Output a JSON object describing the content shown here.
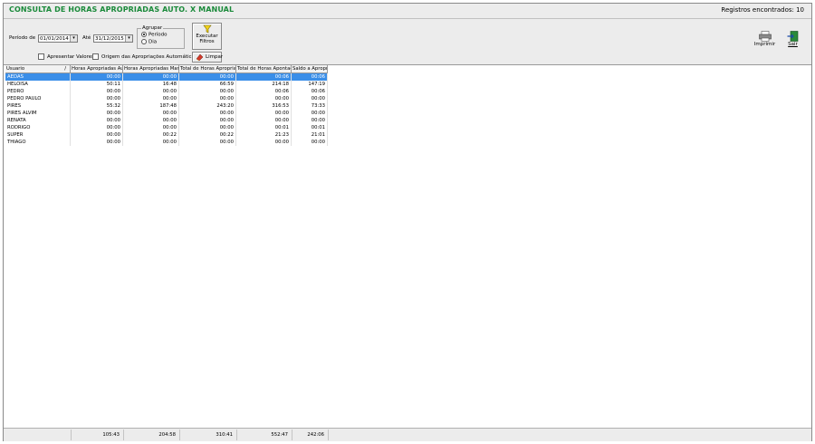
{
  "header": {
    "title": "CONSULTA DE HORAS APROPRIADAS AUTO. X MANUAL",
    "records": "Registros encontrados: 10"
  },
  "filters": {
    "period_label": "Período de",
    "date_from": "01/01/2014",
    "until_label": "Até",
    "date_to": "31/12/2015",
    "group_title": "Agrupar",
    "group_options": [
      "Período",
      "Dia"
    ],
    "group_selected": "Período",
    "show_values_label": "Apresentar Valores",
    "origin_label": "Origem das Apropriações Automáticas"
  },
  "buttons": {
    "execute": "Executar Filtros",
    "clear": "Limpar",
    "print": "Imprimir",
    "exit": "Sair"
  },
  "table": {
    "columns": [
      "Usuario",
      "Horas Apropriadas Auto.",
      "Horas Apropriadas Manual",
      "Total de Horas Apropriadas",
      "Total de Horas Apontadas",
      "Saldo a Apropriar"
    ],
    "rows": [
      [
        "AEDAS",
        "00:00",
        "00:00",
        "00:00",
        "00:06",
        "00:06"
      ],
      [
        "HELOISA",
        "50:11",
        "16:48",
        "66:59",
        "214:18",
        "147:19"
      ],
      [
        "PEDRO",
        "00:00",
        "00:00",
        "00:00",
        "00:06",
        "00:06"
      ],
      [
        "PEDRO PAULO",
        "00:00",
        "00:00",
        "00:00",
        "00:00",
        "00:00"
      ],
      [
        "PIRES",
        "55:32",
        "187:48",
        "243:20",
        "316:53",
        "73:33"
      ],
      [
        "PIRES ALVIM",
        "00:00",
        "00:00",
        "00:00",
        "00:00",
        "00:00"
      ],
      [
        "RENATA",
        "00:00",
        "00:00",
        "00:00",
        "00:00",
        "00:00"
      ],
      [
        "RODRIGO",
        "00:00",
        "00:00",
        "00:00",
        "00:01",
        "00:01"
      ],
      [
        "SUPER",
        "00:00",
        "00:22",
        "00:22",
        "21:23",
        "21:01"
      ],
      [
        "THIAGO",
        "00:00",
        "00:00",
        "00:00",
        "00:00",
        "00:00"
      ]
    ],
    "selected_row": 0
  },
  "totals": [
    "105:43",
    "204:58",
    "310:41",
    "552:47",
    "242:06"
  ],
  "colors": {
    "title": "#1a8a3a",
    "selection": "#3a8ee8"
  }
}
